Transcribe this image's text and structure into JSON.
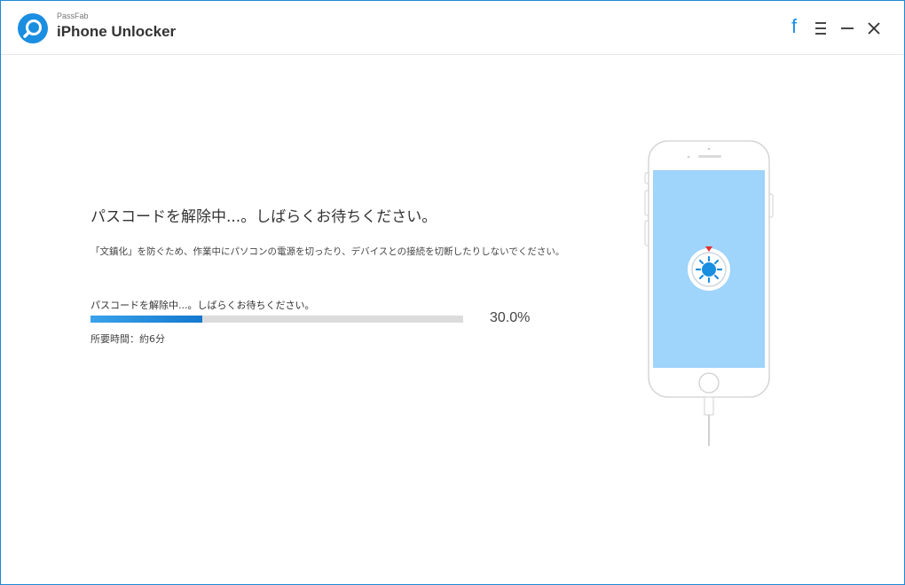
{
  "app": {
    "brand_small": "PassFab",
    "title": "iPhone Unlocker"
  },
  "titlebar": {
    "facebook_glyph": "f",
    "icons": [
      "facebook-icon",
      "menu-icon",
      "minimize-icon",
      "close-icon"
    ]
  },
  "main": {
    "heading": "パスコードを解除中...。しばらくお待ちください。",
    "subtext": "「文鎮化」を防ぐため、作業中にパソコンの電源を切ったり、デバイスとの接続を切断したりしないでください。",
    "progress": {
      "label": "パスコードを解除中...。しばらくお待ちください。",
      "fraction": 0.3,
      "percent_text": "30.0%",
      "time_label": "所要時間：約6分"
    }
  },
  "colors": {
    "accent": "#1a8ee0",
    "window_border": "#1f8ad6",
    "phone_screen": "#9fd4fb",
    "progress_track": "#dcdcdc",
    "indicator_red": "#e53030"
  }
}
